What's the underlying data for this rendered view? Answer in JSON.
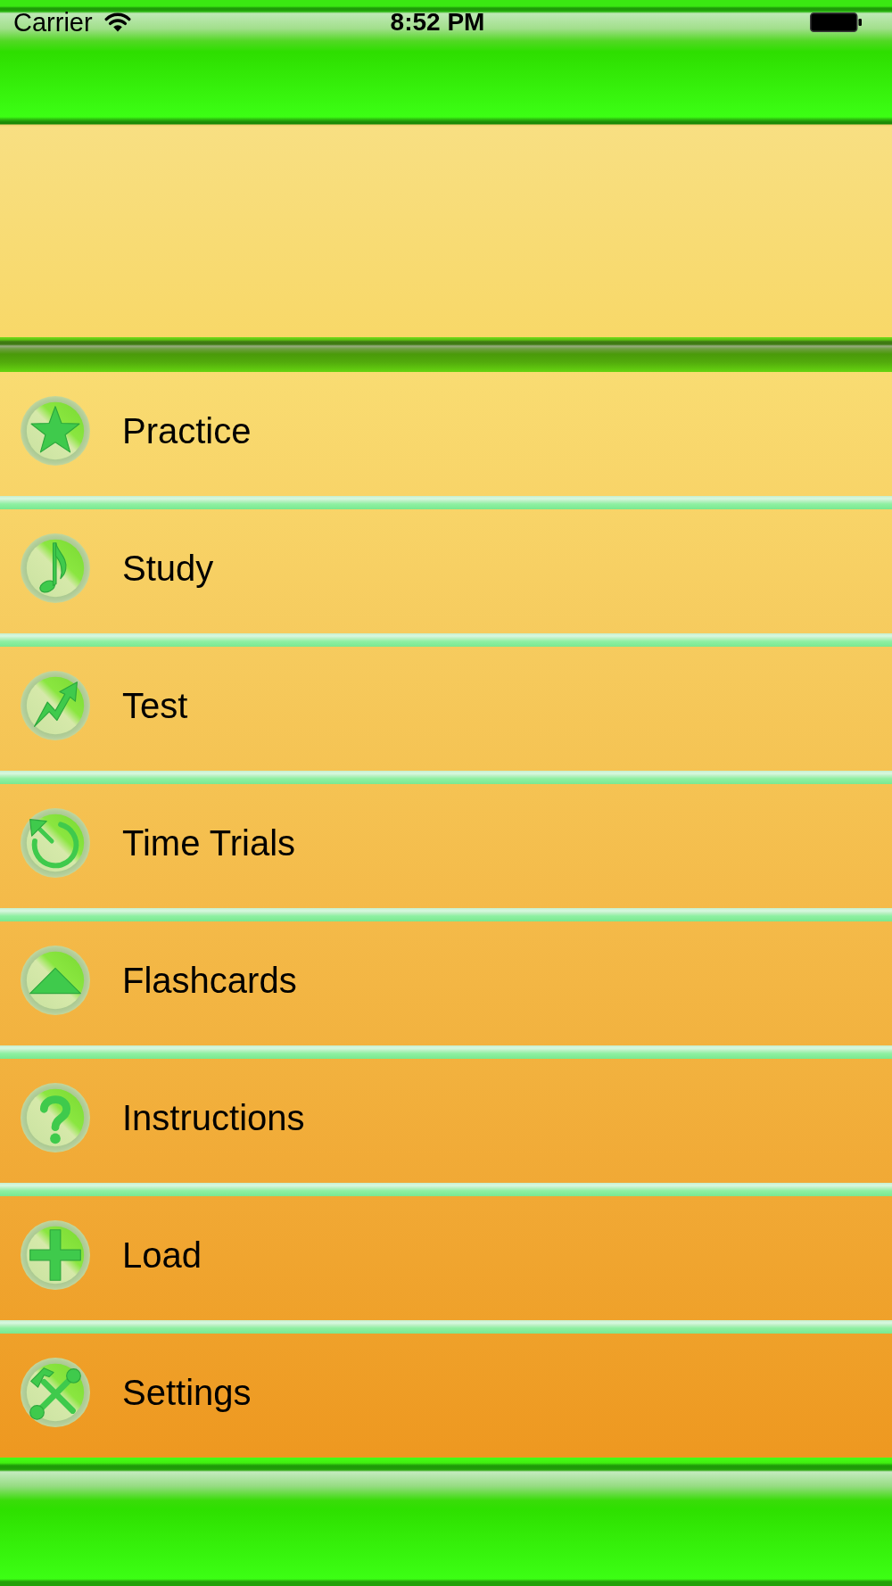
{
  "status_bar": {
    "carrier": "Carrier",
    "time": "8:52 PM"
  },
  "menu": {
    "items": [
      {
        "label": "Practice"
      },
      {
        "label": "Study"
      },
      {
        "label": "Test"
      },
      {
        "label": "Time Trials"
      },
      {
        "label": "Flashcards"
      },
      {
        "label": "Instructions"
      },
      {
        "label": "Load"
      },
      {
        "label": "Settings"
      }
    ]
  }
}
